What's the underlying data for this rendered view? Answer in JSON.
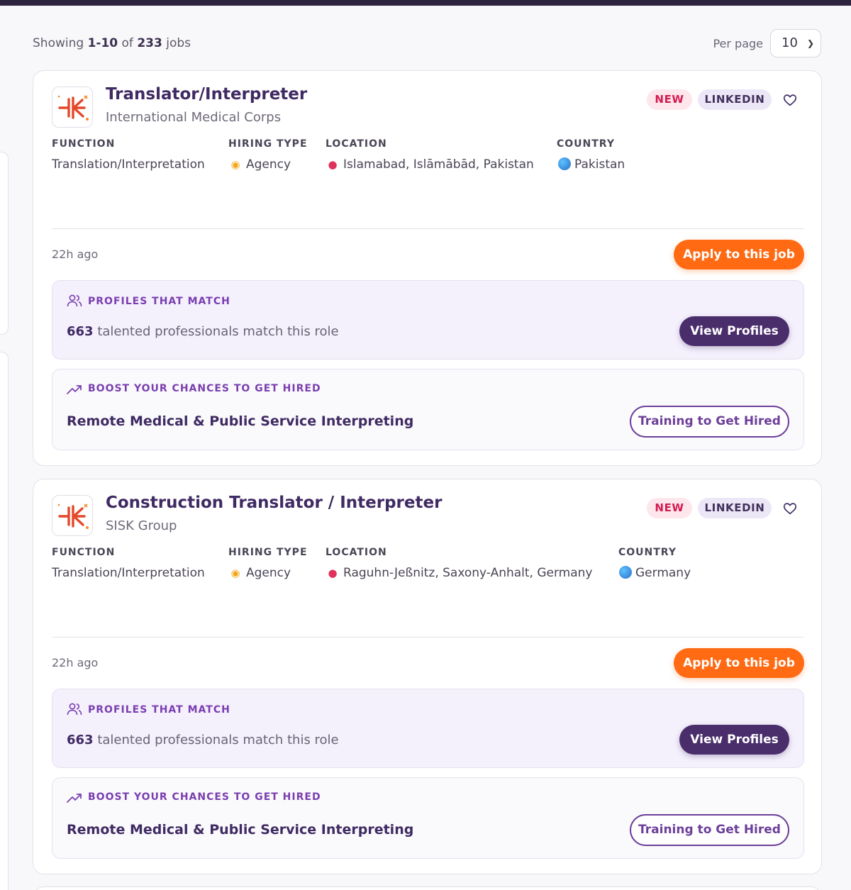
{
  "results": {
    "prefix": "Showing",
    "range": "1-10",
    "of": "of",
    "total": "233",
    "suffix": "jobs",
    "per_page_label": "Per page",
    "per_page_value": "10"
  },
  "jobs": [
    {
      "title": "Translator/Interpreter",
      "company": "International Medical Corps",
      "badge_new": "NEW",
      "badge_source": "LINKEDIN",
      "function_label": "FUNCTION",
      "function": "Translation/Interpretation",
      "hiring_type_label": "HIRING TYPE",
      "hiring_type": "Agency",
      "location_label": "LOCATION",
      "location": "Islamabad, Islāmābād, Pakistan",
      "country_label": "COUNTRY",
      "country": "Pakistan",
      "posted": "22h ago",
      "apply_label": "Apply to this job",
      "match_heading": "PROFILES THAT MATCH",
      "match_count": "663",
      "match_text": "talented professionals match this role",
      "view_profiles_label": "View Profiles",
      "boost_heading": "BOOST YOUR CHANCES TO GET HIRED",
      "course_title": "Remote Medical & Public Service Interpreting",
      "training_label": "Training to Get Hired"
    },
    {
      "title": "Construction Translator / Interpreter",
      "company": "SISK Group",
      "badge_new": "NEW",
      "badge_source": "LINKEDIN",
      "function_label": "FUNCTION",
      "function": "Translation/Interpretation",
      "hiring_type_label": "HIRING TYPE",
      "hiring_type": "Agency",
      "location_label": "LOCATION",
      "location": "Raguhn-Jeßnitz, Saxony-Anhalt, Germany",
      "country_label": "COUNTRY",
      "country": "Germany",
      "posted": "22h ago",
      "apply_label": "Apply to this job",
      "match_heading": "PROFILES THAT MATCH",
      "match_count": "663",
      "match_text": "talented professionals match this role",
      "view_profiles_label": "View Profiles",
      "boost_heading": "BOOST YOUR CHANCES TO GET HIRED",
      "course_title": "Remote Medical & Public Service Interpreting",
      "training_label": "Training to Get Hired"
    }
  ],
  "icons": {
    "logo": "company-logo-icon",
    "favorite": "heart-icon",
    "hiring_type": "handshake-icon",
    "location": "pin-icon",
    "country": "globe-icon",
    "match": "users-icon",
    "boost": "trending-up-icon",
    "select": "chevron-down-icon"
  },
  "colors": {
    "accent_orange": "#ff6a13",
    "brand_purple": "#4a2d6b",
    "heading_purple": "#7a3eb0",
    "new_badge": "#d41c52"
  }
}
